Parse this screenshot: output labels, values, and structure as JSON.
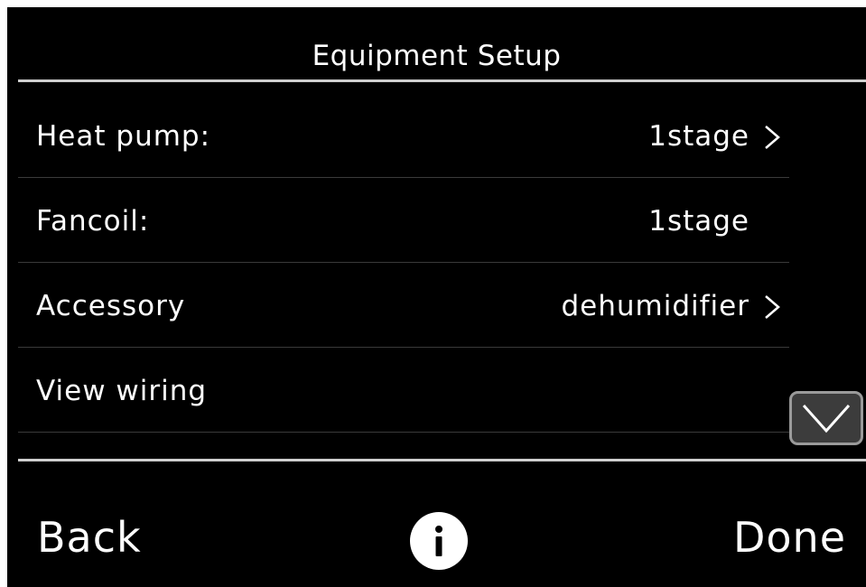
{
  "header": {
    "title": "Equipment Setup"
  },
  "list": {
    "items": [
      {
        "label": "Heat pump:",
        "value": "1stage",
        "has_chevron": true
      },
      {
        "label": "Fancoil:",
        "value": "1stage",
        "has_chevron": false
      },
      {
        "label": "Accessory",
        "value": "dehumidifier",
        "has_chevron": true
      },
      {
        "label": "View wiring",
        "value": "",
        "has_chevron": false
      }
    ]
  },
  "footer": {
    "back_label": "Back",
    "done_label": "Done",
    "info_icon": "info-icon"
  },
  "colors": {
    "background": "#000000",
    "text": "#ffffff",
    "divider": "#cfcfcf",
    "row_divider": "#3a3a3a",
    "scroll_button_fill": "#3c3c3c",
    "scroll_button_border": "#9a9a9a"
  }
}
